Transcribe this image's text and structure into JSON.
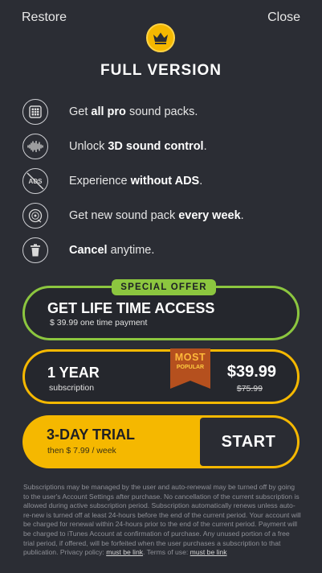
{
  "header": {
    "restore_label": "Restore",
    "close_label": "Close"
  },
  "title": "FULL VERSION",
  "features": [
    {
      "icon": "grid-icon",
      "pre": "Get ",
      "bold": "all pro",
      "post": " sound packs."
    },
    {
      "icon": "soundwave-icon",
      "pre": "Unlock ",
      "bold": "3D sound control",
      "post": "."
    },
    {
      "icon": "no-ads-icon",
      "pre": "Experience ",
      "bold": "without ADS",
      "post": "."
    },
    {
      "icon": "disc-icon",
      "pre": "Get new sound pack ",
      "bold": "every week",
      "post": "."
    },
    {
      "icon": "trash-icon",
      "pre": "",
      "bold": "Cancel",
      "post": " anytime."
    }
  ],
  "ads_icon_text": "ADS",
  "plans": {
    "lifetime": {
      "tag": "SPECIAL OFFER",
      "title": "GET LIFE TIME ACCESS",
      "subtitle": "$ 39.99 one time payment"
    },
    "year": {
      "title": "1 YEAR",
      "subtitle": "subscription",
      "badge_main": "MOST",
      "badge_sub": "POPULAR",
      "price": "$39.99",
      "old_price": "$75.99"
    },
    "trial": {
      "title": "3-DAY TRIAL",
      "subtitle": "then $ 7.99 / week",
      "button": "START"
    }
  },
  "legal": {
    "text": "Subscriptions may be managed by the user and auto-renewal may be turned off by going to the user's Account Settings after purchase. No cancellation of the current subscription is allowed during active subscription period. Subscription automatically renews unless auto-re-new is turned off at least 24-hours before the end of the current period. Your account will be charged for renewal within 24-hours prior to the end of the current period. Payment will be charged to iTunes Account at confirmation of purchase. Any unused portion of a free trial period, if offered, will be forfeited when the user purchases a subscription to that publication.",
    "privacy_label": "Privacy policy:",
    "privacy_link": "must be link",
    "terms_label": "Terms of use:",
    "terms_link": "must be link"
  },
  "colors": {
    "background": "#2b2d34",
    "accent_yellow": "#f5b800",
    "accent_green": "#8cc63f",
    "badge_orange": "#b5501e"
  }
}
